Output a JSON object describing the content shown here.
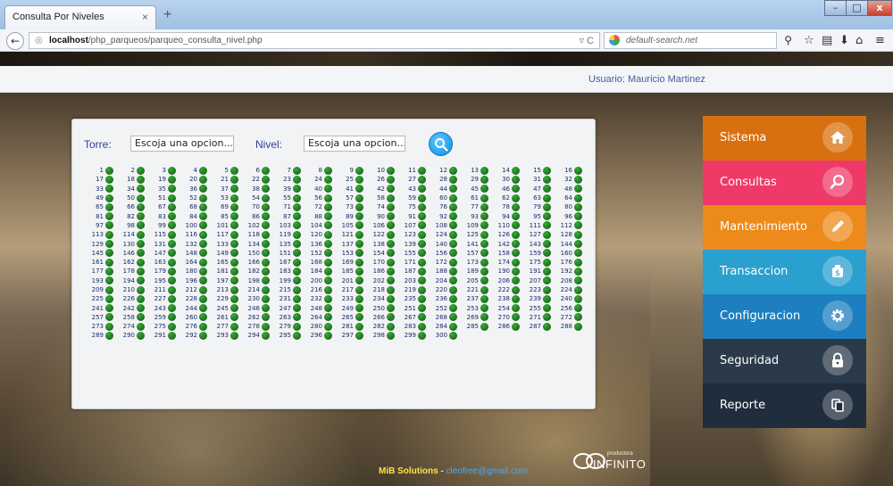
{
  "browser": {
    "tab_title": "Consulta Por Niveles",
    "tab_close": "×",
    "new_tab": "+",
    "url_host": "localhost",
    "url_path": "/php_parqueos/parqueo_consulta_nivel.php",
    "search_placeholder": "default-search.net"
  },
  "header": {
    "user_label": "Usuario: Mauricio Martinez"
  },
  "filters": {
    "torre_label": "Torre:",
    "torre_value": "Escoja una opcion...",
    "nivel_label": "Nivel:",
    "nivel_value": "Escoja una opcion..."
  },
  "spots": {
    "count": 300,
    "status_color": "#0c5a0c"
  },
  "menu": {
    "items": [
      {
        "label": "Sistema",
        "icon": "home-icon",
        "color": "#d9700f"
      },
      {
        "label": "Consultas",
        "icon": "search-icon",
        "color": "#ef3a67"
      },
      {
        "label": "Mantenimiento",
        "icon": "pencil-icon",
        "color": "#ec8a1b"
      },
      {
        "label": "Transaccion",
        "icon": "money-bag-icon",
        "color": "#2aa0cf"
      },
      {
        "label": "Configuracion",
        "icon": "gear-icon",
        "color": "#1c7fc0"
      },
      {
        "label": "Seguridad",
        "icon": "lock-icon",
        "color": "#2b3a4a"
      },
      {
        "label": "Reporte",
        "icon": "copy-icon",
        "color": "#1f2d3c"
      }
    ]
  },
  "footer": {
    "brand": "MiB Solutions - ",
    "email": "cleofree@gmail.com",
    "logo_text": "INFINITO",
    "logo_sub": "productora"
  }
}
